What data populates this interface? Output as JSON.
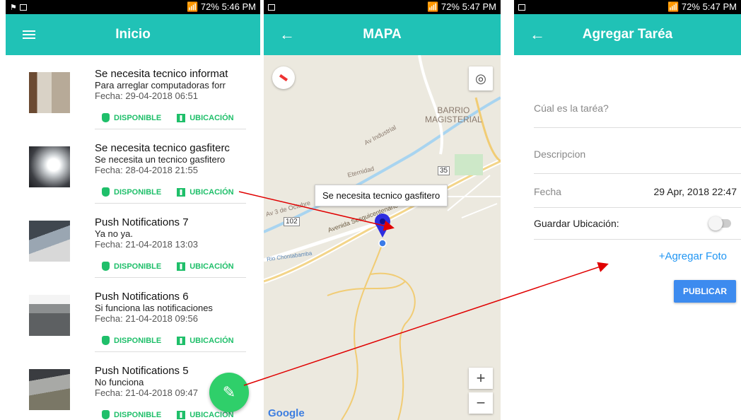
{
  "screens": {
    "home": {
      "status": {
        "battery": "72%",
        "time": "5:46 PM"
      },
      "title": "Inicio",
      "items": [
        {
          "title": "Se necesita tecnico informat",
          "desc": "Para arreglar computadoras forr",
          "date": "Fecha: 29-04-2018 06:51",
          "action1": "DISPONIBLE",
          "action2": "UBICACIÓN"
        },
        {
          "title": "Se necesita tecnico gasfiterc",
          "desc": "Se necesita un tecnico gasfitero",
          "date": "Fecha: 28-04-2018 21:55",
          "action1": "DISPONIBLE",
          "action2": "UBICACIÓN"
        },
        {
          "title": "Push Notifications 7",
          "desc": "Ya no ya.",
          "date": "Fecha: 21-04-2018 13:03",
          "action1": "DISPONIBLE",
          "action2": "UBICACIÓN"
        },
        {
          "title": "Push Notifications 6",
          "desc": "Si funciona las notificaciones",
          "date": "Fecha: 21-04-2018 09:56",
          "action1": "DISPONIBLE",
          "action2": "UBICACIÓN"
        },
        {
          "title": "Push Notifications 5",
          "desc": "No funciona",
          "date": "Fecha: 21-04-2018 09:47",
          "action1": "DISPONIBLE",
          "action2": "UBICACIÓN"
        }
      ],
      "fab_icon": "edit-icon"
    },
    "map": {
      "status": {
        "battery": "72%",
        "time": "5:47 PM"
      },
      "title": "MAPA",
      "tooltip": "Se necesita tecnico gasfitero",
      "labels": [
        "BARRIO",
        "MAGISTERIAL",
        "Av Industrial",
        "Av 3 de Octubre",
        "Avenida Sesquicentenario",
        "Rio Chontabamba",
        "Eternidad",
        "102",
        "35"
      ],
      "zoom_in": "+",
      "zoom_out": "−",
      "logo": "Google"
    },
    "form": {
      "status": {
        "battery": "72%",
        "time": "5:47 PM"
      },
      "title": "Agregar Taréa",
      "task_placeholder": "Cúal es la taréa?",
      "desc_placeholder": "Descripcion",
      "date_label": "Fecha",
      "date_value": "29 Apr, 2018 22:47",
      "location_label": "Guardar Ubicación:",
      "location_toggle": false,
      "add_photo": "+Agregar Foto",
      "publish": "PUBLICAR"
    }
  },
  "colors": {
    "appbar": "#20c2b6",
    "action_green": "#1fbf6a",
    "fab": "#2fcf6a",
    "publish_blue": "#3d8bef",
    "link_blue": "#2196f3",
    "arrow_red": "#e00000"
  }
}
